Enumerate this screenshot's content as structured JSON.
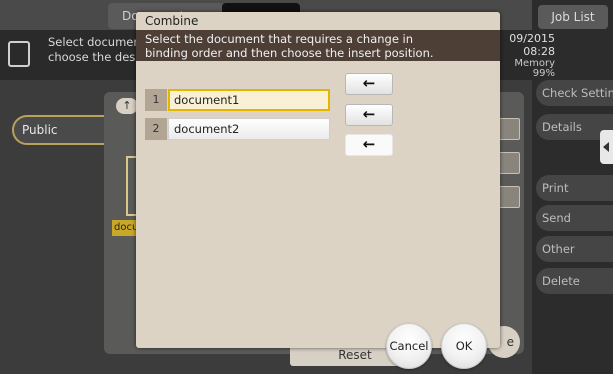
{
  "background": {
    "top_tabs": [
      "Document",
      "",
      "Job List"
    ],
    "info_message": "Select documen\nchoose the desi",
    "date": "09/2015",
    "time": "08:28",
    "memory_label": "Memory",
    "memory_value": "99%",
    "public_label": "Public",
    "up_icon_glyph": "↑",
    "doc_label": "docu",
    "right_buttons": [
      "Check Setting",
      "Details",
      "Print",
      "Send",
      "Other",
      "Delete"
    ],
    "reset_label": "Reset",
    "ce_label": "e"
  },
  "dialog": {
    "title": "Combine",
    "message": "Select the document that requires a change in\nbinding order and  then choose the insert position.",
    "documents": [
      {
        "number": "1",
        "name": "document1",
        "selected": true
      },
      {
        "number": "2",
        "name": "document2",
        "selected": false
      }
    ],
    "insert_arrows": [
      "←",
      "←",
      "←"
    ],
    "cancel_label": "Cancel",
    "ok_label": "OK"
  },
  "icons": {
    "document_icon": "document-icon",
    "arrow": "left-arrow-icon"
  },
  "colors": {
    "dialog_bg": "#ddd3c5",
    "message_bar": "#4e3f36",
    "selected_border": "#e3b700",
    "public_border": "#b8a15a"
  }
}
